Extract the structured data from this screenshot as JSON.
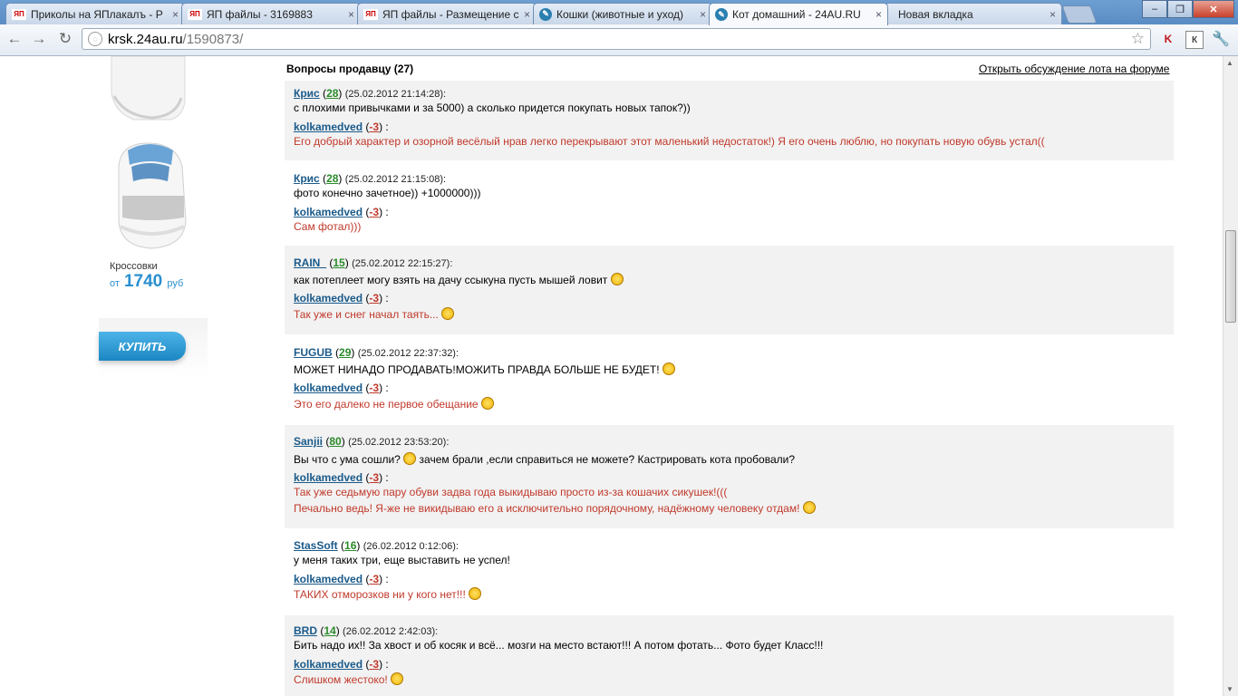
{
  "browser": {
    "tabs": [
      {
        "favicon": "ЯП",
        "title": "Приколы на ЯПлакалъ - Р",
        "active": false
      },
      {
        "favicon": "ЯП",
        "title": "ЯП файлы - 3169883",
        "active": false
      },
      {
        "favicon": "ЯП",
        "title": "ЯП файлы - Размещение с",
        "active": false
      },
      {
        "favicon": "cat",
        "title": "Кошки (животные и уход)",
        "active": false
      },
      {
        "favicon": "cat",
        "title": "Кот домашний - 24AU.RU",
        "active": true
      },
      {
        "favicon": "",
        "title": "Новая вкладка",
        "active": false
      }
    ],
    "close_glyph": "×",
    "url_host": "krsk.24au.ru",
    "url_path": "/1590873/",
    "ext_glyph_k": "К",
    "icons": {
      "back": "back-arrow-icon",
      "forward": "forward-arrow-icon",
      "reload": "reload-icon",
      "star": "star-icon",
      "wrench": "wrench-icon"
    }
  },
  "product": {
    "name": "Кроссовки",
    "price_prefix": "от",
    "price": "1740",
    "currency": "руб",
    "buy_label": "КУПИТЬ"
  },
  "questions": {
    "title": "Вопросы продавцу (27)",
    "forum_link": "Открыть обсуждение лота на форуме",
    "items": [
      {
        "author": "Крис",
        "rating": "28",
        "date": "(25.02.2012 21:14:28):",
        "question": "с плохими привычками и за 5000) а сколько придется покупать новых тапок?))",
        "seller": "kolkamedved",
        "seller_rating": "-3",
        "answer": [
          "Его добрый характер и озорной весёлый нрав легко перекрывают этот маленький недостаток!) Я его очень люблю, но покупать новую обувь устал(("
        ]
      },
      {
        "author": "Крис",
        "rating": "28",
        "date": "(25.02.2012 21:15:08):",
        "question": "фото конечно зачетное)) +1000000)))",
        "seller": "kolkamedved",
        "seller_rating": "-3",
        "answer": [
          "Сам фотал)))"
        ]
      },
      {
        "author": "RAIN_",
        "rating": "15",
        "date": "(25.02.2012 22:15:27):",
        "question": "как потеплеет могу взять на дачу ссыкуна пусть мышей ловит",
        "seller": "kolkamedved",
        "seller_rating": "-3",
        "answer": [
          "Так уже и снег начал таять..."
        ]
      },
      {
        "author": "FUGUB",
        "rating": "29",
        "date": "(25.02.2012 22:37:32):",
        "question": "МОЖЕТ НИНАДО ПРОДАВАТЬ!МОЖИТЬ ПРАВДА БОЛЬШЕ НЕ БУДЕТ!",
        "seller": "kolkamedved",
        "seller_rating": "-3",
        "answer": [
          "Это его далеко не первое обещание"
        ]
      },
      {
        "author": "Sanjii",
        "rating": "80",
        "date": "(25.02.2012 23:53:20):",
        "question_a": "Вы что с ума сошли?",
        "question_b": "зачем брали ,если справиться не можете? Кастрировать кота пробовали?",
        "seller": "kolkamedved",
        "seller_rating": "-3",
        "answer": [
          "Так уже седьмую пару обуви задва года выкидываю просто из-за кошачих сикушек!(((",
          "Печально ведь! Я-же не викидываю его а исключительно порядочному, надёжному человеку отдам!"
        ]
      },
      {
        "author": "StasSoft",
        "rating": "16",
        "date": "(26.02.2012 0:12:06):",
        "question": "у меня таких три, еще выставить не успел!",
        "seller": "kolkamedved",
        "seller_rating": "-3",
        "answer": [
          "ТАКИХ отморозков ни у кого нет!!!"
        ]
      },
      {
        "author": "BRD",
        "rating": "14",
        "date": "(26.02.2012 2:42:03):",
        "question": "Бить надо их!! За хвост и об косяк и всё... мозги на место встают!!! А потом фотать... Фото будет Класс!!!",
        "seller": "kolkamedved",
        "seller_rating": "-3",
        "answer": [
          "Слишком жестоко!"
        ]
      }
    ]
  },
  "colors": {
    "author_link": "#1a5a8a",
    "rating_positive": "#2a8a2a",
    "rating_negative": "#c0392b",
    "answer_text": "#c0392b",
    "row_grey": "#f2f2f2",
    "price_blue": "#2a8fd0",
    "buy_button": "#1b86c2"
  }
}
